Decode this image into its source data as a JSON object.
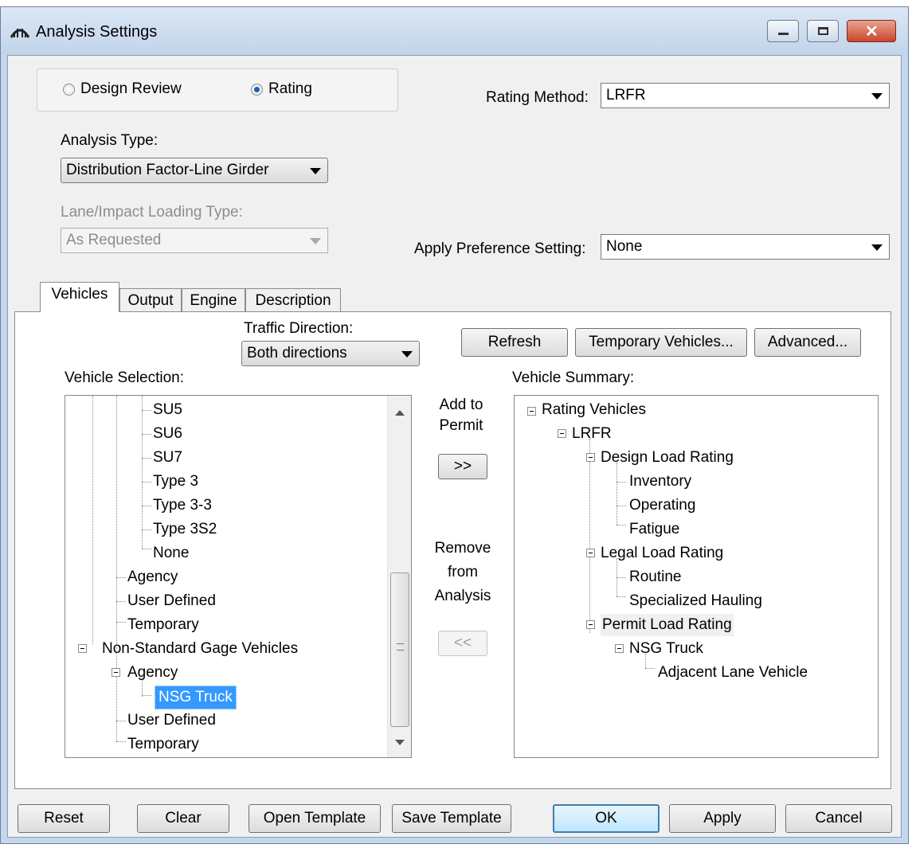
{
  "window": {
    "title": "Analysis Settings",
    "minimize_label": "—",
    "maximize_label": "□",
    "close_label": "✕"
  },
  "mode": {
    "options": [
      {
        "label": "Design Review",
        "selected": false
      },
      {
        "label": "Rating",
        "selected": true
      }
    ]
  },
  "rating_method": {
    "label": "Rating Method:",
    "value": "LRFR"
  },
  "analysis_type": {
    "label": "Analysis Type:",
    "value": "Distribution Factor-Line Girder"
  },
  "lane_impact": {
    "label": "Lane/Impact Loading Type:",
    "value": "As Requested"
  },
  "preference": {
    "label": "Apply Preference Setting:",
    "value": "None"
  },
  "tabs": [
    {
      "label": "Vehicles",
      "active": true
    },
    {
      "label": "Output"
    },
    {
      "label": "Engine"
    },
    {
      "label": "Description"
    }
  ],
  "traffic": {
    "label": "Traffic Direction:",
    "value": "Both directions"
  },
  "buttons": {
    "refresh": "Refresh",
    "temporary": "Temporary Vehicles...",
    "advanced": "Advanced...",
    "add_to_permit": "Add to Permit",
    "add_arrow": ">>",
    "remove_label": "Remove from Analysis",
    "remove_arrow": "<<"
  },
  "vehicle_selection": {
    "label": "Vehicle Selection:",
    "items": [
      "SU5",
      "SU6",
      "SU7",
      "Type 3",
      "Type 3-3",
      "Type 3S2",
      "None",
      "Agency",
      "User Defined",
      "Temporary",
      "Non-Standard Gage Vehicles",
      "Agency",
      "NSG Truck",
      "User Defined",
      "Temporary"
    ]
  },
  "vehicle_summary": {
    "label": "Vehicle Summary:",
    "items": [
      "Rating Vehicles",
      "LRFR",
      "Design Load Rating",
      "Inventory",
      "Operating",
      "Fatigue",
      "Legal Load Rating",
      "Routine",
      "Specialized Hauling",
      "Permit Load Rating",
      "NSG Truck",
      "Adjacent Lane Vehicle"
    ]
  },
  "footer": {
    "reset": "Reset",
    "clear": "Clear",
    "open_template": "Open Template",
    "save_template": "Save Template",
    "ok": "OK",
    "apply": "Apply",
    "cancel": "Cancel"
  },
  "colors": {
    "selection": "#3399ff",
    "titlebar": "#c2d4ea"
  }
}
